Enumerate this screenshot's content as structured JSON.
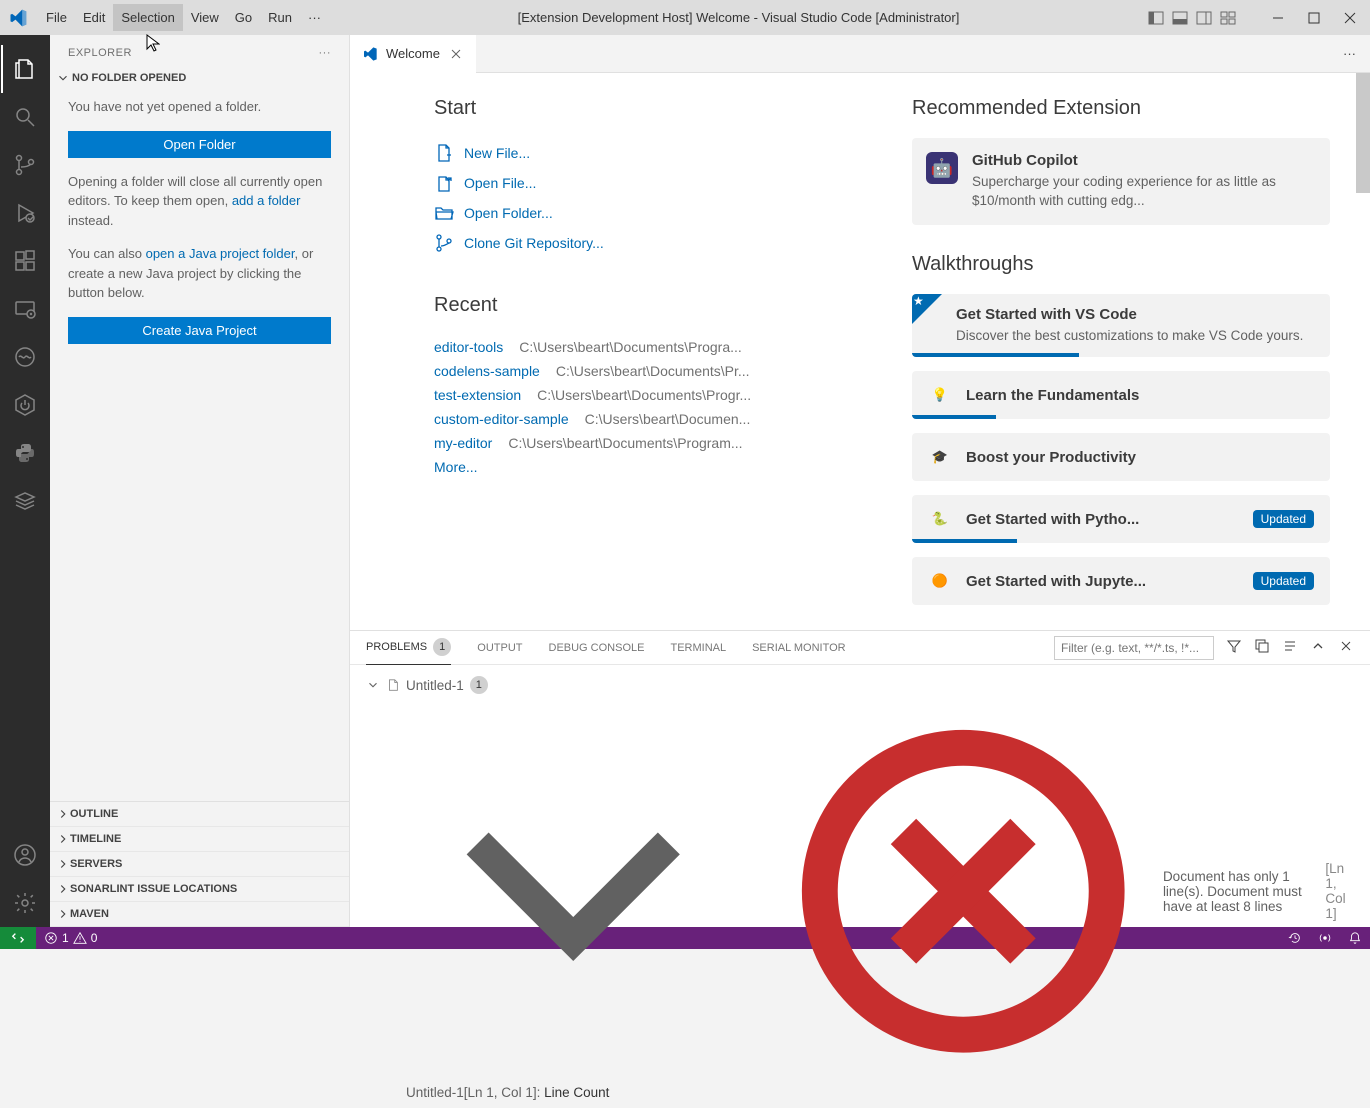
{
  "title": "[Extension Development Host] Welcome - Visual Studio Code [Administrator]",
  "menu": [
    "File",
    "Edit",
    "Selection",
    "View",
    "Go",
    "Run"
  ],
  "sidebar": {
    "header": "EXPLORER",
    "section": "NO FOLDER OPENED",
    "p1": "You have not yet opened a folder.",
    "btn_open": "Open Folder",
    "p2a": "Opening a folder will close all currently open editors. To keep them open, ",
    "p2_link": "add a folder",
    "p2b": " instead.",
    "p3a": "You can also ",
    "p3_link": "open a Java project folder",
    "p3b": ", or create a new Java project by clicking the button below.",
    "btn_java": "Create Java Project",
    "collapsed": [
      "OUTLINE",
      "TIMELINE",
      "SERVERS",
      "SONARLINT ISSUE LOCATIONS",
      "MAVEN"
    ]
  },
  "tab_label": "Welcome",
  "welcome": {
    "start_h": "Start",
    "start_items": [
      "New File...",
      "Open File...",
      "Open Folder...",
      "Clone Git Repository..."
    ],
    "recent_h": "Recent",
    "recent": [
      {
        "name": "editor-tools",
        "path": "C:\\Users\\beart\\Documents\\Progra..."
      },
      {
        "name": "codelens-sample",
        "path": "C:\\Users\\beart\\Documents\\Pr..."
      },
      {
        "name": "test-extension",
        "path": "C:\\Users\\beart\\Documents\\Progr..."
      },
      {
        "name": "custom-editor-sample",
        "path": "C:\\Users\\beart\\Documen..."
      },
      {
        "name": "my-editor",
        "path": "C:\\Users\\beart\\Documents\\Program..."
      }
    ],
    "more": "More...",
    "rec_ext_h": "Recommended Extension",
    "ext_title": "GitHub Copilot",
    "ext_desc": "Supercharge your coding experience for as little as $10/month with cutting edg...",
    "walk_h": "Walkthroughs",
    "walk": [
      {
        "title": "Get Started with VS Code",
        "desc": "Discover the best customizations to make VS Code yours.",
        "starred": true,
        "progress": 40
      },
      {
        "title": "Learn the Fundamentals",
        "progress": 20
      },
      {
        "title": "Boost your Productivity"
      },
      {
        "title": "Get Started with Pytho...",
        "updated": "Updated",
        "progress": 25
      },
      {
        "title": "Get Started with Jupyte...",
        "updated": "Updated"
      }
    ]
  },
  "panel": {
    "tabs": [
      "PROBLEMS",
      "OUTPUT",
      "DEBUG CONSOLE",
      "TERMINAL",
      "SERIAL MONITOR"
    ],
    "badge": "1",
    "filter_ph": "Filter (e.g. text, **/*.ts, !*...",
    "file": "Untitled-1",
    "file_badge": "1",
    "msg": "Document has only 1 line(s). Document must have at least 8 lines",
    "loc": "[Ln 1, Col 1]",
    "sub_file": "Untitled-1",
    "sub_loc": "[Ln 1, Col 1]: ",
    "sub_src": "Line Count"
  },
  "status": {
    "errors": "1",
    "warnings": "0"
  }
}
